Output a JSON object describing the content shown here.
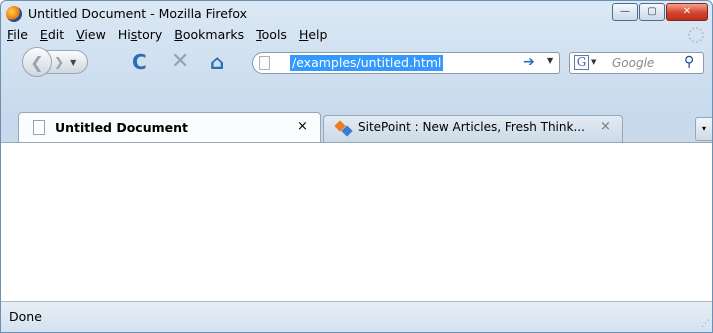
{
  "window": {
    "title": "Untitled Document - Mozilla Firefox",
    "minimize_symbol": "—",
    "maximize_symbol": "▢",
    "close_symbol": "✕"
  },
  "menu": {
    "items": [
      {
        "accel": "F",
        "rest": "ile"
      },
      {
        "accel": "E",
        "rest": "dit"
      },
      {
        "accel": "V",
        "rest": "iew"
      },
      {
        "pre": "Hi",
        "accel": "s",
        "rest": "tory"
      },
      {
        "accel": "B",
        "rest": "ookmarks"
      },
      {
        "accel": "T",
        "rest": "ools"
      },
      {
        "accel": "H",
        "rest": "elp"
      }
    ]
  },
  "navigation": {
    "back_symbol": "❮",
    "forward_symbol": "❯",
    "dropdown_symbol": "▼",
    "reload_symbol": "C",
    "stop_symbol": "✕",
    "home_symbol": "⌂",
    "url": "/examples/untitled.html",
    "go_symbol": "➔",
    "url_dropdown_symbol": "▼"
  },
  "search": {
    "engine_letter": "G",
    "engine_dropdown_symbol": "▼",
    "placeholder": "Google",
    "search_symbol": "⚲"
  },
  "tabs": [
    {
      "label": "Untitled Document",
      "close": "×",
      "active": true
    },
    {
      "label": "SitePoint : New Articles, Fresh Think...",
      "close": "×",
      "active": false
    }
  ],
  "tab_list_symbol": "▾",
  "status": {
    "text": "Done",
    "grip": "⋰"
  }
}
